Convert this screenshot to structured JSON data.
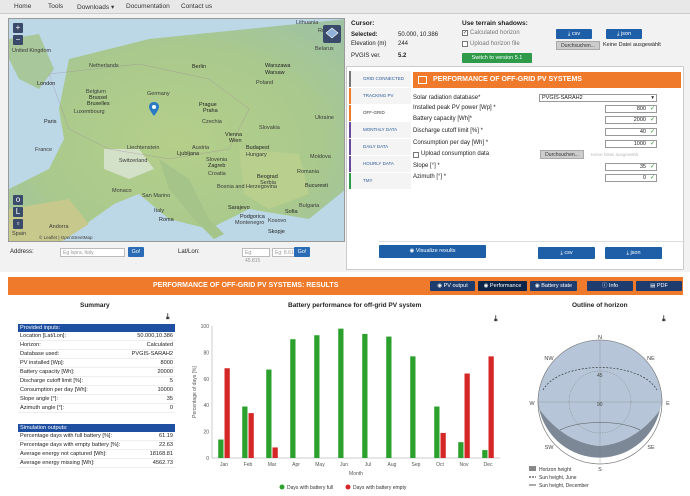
{
  "nav": [
    "Home",
    "Tools",
    "Downloads ▾",
    "Documentation",
    "Contact us"
  ],
  "map": {
    "labels": [
      "Lithuania",
      "Russia",
      "Belarus",
      "Netherlands",
      "Berlin",
      "Warszawa",
      "Warsaw",
      "Poland",
      "London",
      "United Kingdom",
      "Belgium",
      "Brussel",
      "Bruxelles",
      "Luxembourg",
      "Germany",
      "Prague",
      "Praha",
      "Czechia",
      "Slovakia",
      "France",
      "Paris",
      "Ukraine",
      "Vienna",
      "Wien",
      "Austria",
      "Hungary",
      "Budapest",
      "Liechtenstein",
      "Switzerland",
      "Slovenia",
      "Ljubljana",
      "Zagreb",
      "Croatia",
      "Moldova",
      "Romania",
      "Bosnia and Herzegovina",
      "Serbia",
      "Beograd",
      "Bucuresti",
      "Monaco",
      "San Marino",
      "Roma",
      "Italy",
      "Sarajevo",
      "Podgorica",
      "Montenegro",
      "Bulgaria",
      "Sofia",
      "Kosovo",
      "Skopje",
      "Andorra",
      "Spain"
    ],
    "attribution": "© Leaflet | OpenStreetMap",
    "layers_icon": "layers-icon"
  },
  "address": {
    "label": "Address:",
    "placeholder": "Eg Ispra, Italy",
    "go": "Go!"
  },
  "latlon": {
    "label": "Lat/Lon:",
    "lat_placeholder": "Eg: 45.815",
    "lon_placeholder": "Eg: 8.611",
    "go": "Go!"
  },
  "cursor": {
    "title": "Cursor:",
    "selected_label": "Selected:",
    "selected_value": "50.000, 10.386",
    "elevation_label": "Elevation (m)",
    "elevation_value": "244",
    "version_label": "PVGIS ver.",
    "version_value": "5.2"
  },
  "terrain": {
    "title": "Use terrain shadows:",
    "calc_horizon": "Calculated horizon",
    "upload_horizon": "Upload horizon file",
    "switch_btn": "Switch to version 5.1",
    "csv": "csv",
    "json": "json",
    "browse": "Durchsuchen...",
    "no_file": "Keine Datei ausgewählt"
  },
  "side_tabs": [
    "GRID CONNECTED",
    "TRACKING PV",
    "OFF-GRID",
    "MONTHLY DATA",
    "DAILY DATA",
    "HOURLY DATA",
    "TMY"
  ],
  "offgrid": {
    "title": "PERFORMANCE OF OFF-GRID PV SYSTEMS",
    "db_label": "Solar radiation database*",
    "db_value": "PVGIS-SARAH2",
    "power_label": "Installed peak PV power [Wp] *",
    "power_value": "800",
    "battery_label": "Battery capacity [Wh]*",
    "battery_value": "2000",
    "cutoff_label": "Discharge cutoff limit [%] *",
    "cutoff_value": "40",
    "consumption_label": "Consumption per day [Wh] *",
    "consumption_value": "1000",
    "upload_label": "Upload consumption data",
    "browse": "Durchsuchen...",
    "no_file": "Keine Datei ausgewählt",
    "slope_label": "Slope [°] *",
    "slope_value": "35",
    "azimuth_label": "Azimuth [°] *",
    "azimuth_value": "0",
    "visualize": "Visualize results",
    "csv": "csv",
    "json": "json"
  },
  "results": {
    "title": "PERFORMANCE OF OFF-GRID PV SYSTEMS: RESULTS",
    "tabs": [
      "PV output",
      "Performance",
      "Battery state",
      "Info",
      "PDF"
    ]
  },
  "summary": {
    "title": "Summary",
    "inputs_hdr": "Provided inputs:",
    "inputs": [
      [
        "Location [Lat/Lon]:",
        "50.000,10.386"
      ],
      [
        "Horizon:",
        "Calculated"
      ],
      [
        "Database used:",
        "PVGIS-SARAH2"
      ],
      [
        "PV installed [Wp]:",
        "8000"
      ],
      [
        "Battery capacity [Wh]:",
        "20000"
      ],
      [
        "Discharge cutoff limit [%]:",
        "5"
      ],
      [
        "Consumption per day [Wh]:",
        "10000"
      ],
      [
        "Slope angle [°]:",
        "35"
      ],
      [
        "Azimuth angle [°]:",
        "0"
      ]
    ],
    "outputs_hdr": "Simulation outputs:",
    "outputs": [
      [
        "Percentage days with full battery [%]:",
        "61.19"
      ],
      [
        "Percentage days with empty battery [%]:",
        "22.63"
      ],
      [
        "Average energy not captured [Wh]:",
        "18168.81"
      ],
      [
        "Average energy missing [Wh]:",
        "4562.73"
      ]
    ]
  },
  "chart_data": {
    "type": "bar",
    "title": "Battery performance for off-grid PV system",
    "xlabel": "Month",
    "ylabel": "Percentage of days [%]",
    "ylim": [
      0,
      100
    ],
    "yticks": [
      0,
      20,
      40,
      60,
      80,
      100
    ],
    "categories": [
      "Jan",
      "Feb",
      "Mar",
      "Apr",
      "May",
      "Jun",
      "Jul",
      "Aug",
      "Sep",
      "Oct",
      "Nov",
      "Dec"
    ],
    "series": [
      {
        "name": "Days with battery full",
        "color": "#2ca02c",
        "values": [
          14,
          39,
          67,
          90,
          93,
          98,
          94,
          92,
          77,
          39,
          12,
          6
        ]
      },
      {
        "name": "Days with battery empty",
        "color": "#d62728",
        "values": [
          68,
          34,
          8,
          0,
          0,
          0,
          0,
          0,
          0,
          19,
          64,
          77
        ]
      }
    ],
    "legend": "bottom",
    "grid": false
  },
  "horizon": {
    "title": "Outline of horizon",
    "compass": [
      "N",
      "NE",
      "E",
      "SE",
      "S",
      "SW",
      "W",
      "NW"
    ],
    "ring_labels": [
      "45",
      "90"
    ],
    "legend": [
      "Horizon height",
      "Sun height, June",
      "Sun height, December"
    ]
  }
}
